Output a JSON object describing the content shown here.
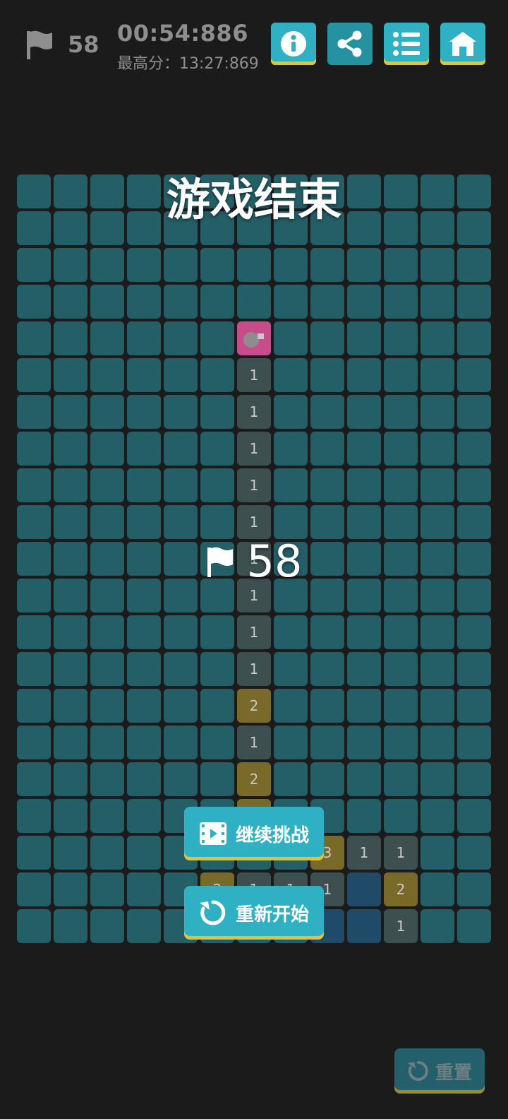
{
  "header": {
    "flags_remaining": "58",
    "elapsed_time": "00:54:886",
    "best_score": "最高分：13:27:869"
  },
  "toolbar": {
    "buttons": [
      {
        "icon": "info-icon"
      },
      {
        "icon": "share-icon"
      },
      {
        "icon": "list-icon"
      },
      {
        "icon": "home-icon"
      }
    ]
  },
  "board": {
    "columns": 13,
    "rows": 21,
    "revealed_cells": [
      {
        "row": 4,
        "col": 6,
        "type": "mine"
      },
      {
        "row": 5,
        "col": 6,
        "value": "1"
      },
      {
        "row": 6,
        "col": 6,
        "value": "1"
      },
      {
        "row": 7,
        "col": 6,
        "value": "1"
      },
      {
        "row": 8,
        "col": 6,
        "value": "1"
      },
      {
        "row": 9,
        "col": 6,
        "value": "1"
      },
      {
        "row": 10,
        "col": 6,
        "value": "1"
      },
      {
        "row": 11,
        "col": 6,
        "value": "1"
      },
      {
        "row": 12,
        "col": 6,
        "value": "1"
      },
      {
        "row": 13,
        "col": 6,
        "value": "1"
      },
      {
        "row": 14,
        "col": 6,
        "value": "2"
      },
      {
        "row": 15,
        "col": 6,
        "value": "1"
      },
      {
        "row": 16,
        "col": 6,
        "value": "2"
      },
      {
        "row": 17,
        "col": 6,
        "value": "2"
      },
      {
        "row": 18,
        "col": 8,
        "value": "3"
      },
      {
        "row": 18,
        "col": 9,
        "value": "1"
      },
      {
        "row": 18,
        "col": 10,
        "value": "1"
      },
      {
        "row": 19,
        "col": 5,
        "value": "2"
      },
      {
        "row": 19,
        "col": 6,
        "value": "1"
      },
      {
        "row": 19,
        "col": 7,
        "value": "1"
      },
      {
        "row": 19,
        "col": 8,
        "value": "1"
      },
      {
        "row": 19,
        "col": 9,
        "type": "blank"
      },
      {
        "row": 19,
        "col": 10,
        "value": "2"
      },
      {
        "row": 20,
        "col": 8,
        "type": "blank"
      },
      {
        "row": 20,
        "col": 9,
        "type": "blank"
      },
      {
        "row": 20,
        "col": 10,
        "value": "1"
      }
    ]
  },
  "overlay": {
    "title": "游戏结束",
    "flag_count": "58",
    "continue_label": "继续挑战",
    "restart_label": "重新开始"
  },
  "reset": {
    "label": "重置"
  },
  "colors": {
    "accent": "#2fb1c3",
    "accent_bottom": "#e6c233",
    "hidden_cell": "#245e67",
    "mine_cell": "#c64d8a",
    "background": "#1b1b1b"
  }
}
